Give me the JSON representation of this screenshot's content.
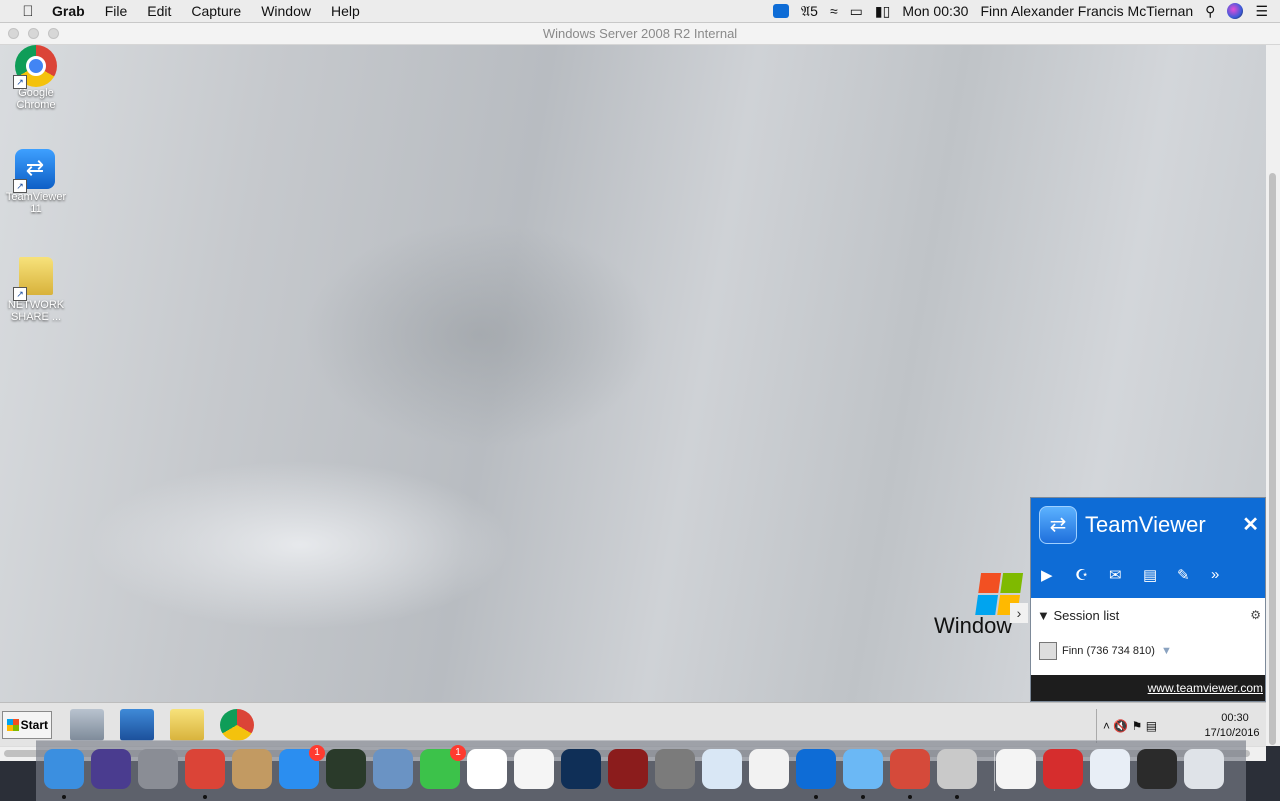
{
  "menubar": {
    "app_name": "Grab",
    "menus": [
      "File",
      "Edit",
      "Capture",
      "Window",
      "Help"
    ],
    "status": {
      "input_badge": "5",
      "clock": "Mon 00:30",
      "user_name": "Finn Alexander Francis McTiernan"
    }
  },
  "window": {
    "title": "Windows Server 2008 R2 Internal"
  },
  "desktop": {
    "icons": [
      {
        "label": "Google Chrome",
        "icon": "chrome-icon"
      },
      {
        "label": "TeamViewer 11",
        "icon": "teamviewer-icon"
      },
      {
        "label": "NETWORK SHARE ...",
        "icon": "folder-icon"
      }
    ],
    "brand_text": "Window"
  },
  "teamviewer": {
    "title": "TeamViewer",
    "toolbar_icons": [
      "video-icon",
      "headset-icon",
      "chat-icon",
      "file-transfer-icon",
      "tools-icon",
      "more-icon"
    ],
    "session_list_label": "Session list",
    "session_user": "Finn (736 734 810)",
    "footer_link": "www.teamviewer.com",
    "accent_color": "#0e6cd6"
  },
  "taskbar": {
    "start_label": "Start",
    "apps": [
      "server-manager-icon",
      "powershell-icon",
      "explorer-icon",
      "chrome-icon"
    ],
    "clock_time": "00:30",
    "clock_date": "17/10/2016"
  },
  "dock": {
    "items": [
      {
        "name": "finder-icon",
        "color": "#3b8fe0",
        "running": true
      },
      {
        "name": "siri-icon",
        "color": "#4a3c8f",
        "running": false
      },
      {
        "name": "launchpad-icon",
        "color": "#8a8d95",
        "running": false
      },
      {
        "name": "chrome-icon",
        "color": "#db4437",
        "running": true
      },
      {
        "name": "contacts-icon",
        "color": "#c29a62",
        "running": false
      },
      {
        "name": "app-store-icon",
        "color": "#2b8ef0",
        "running": false,
        "badge": "1"
      },
      {
        "name": "activity-monitor-icon",
        "color": "#2a3a2a",
        "running": false
      },
      {
        "name": "preview-icon",
        "color": "#6a93c4",
        "running": false
      },
      {
        "name": "facetime-icon",
        "color": "#3cc24a",
        "running": false,
        "badge": "1"
      },
      {
        "name": "calendar-icon",
        "color": "#ffffff",
        "running": false
      },
      {
        "name": "itunes-icon",
        "color": "#f5f5f5",
        "running": false
      },
      {
        "name": "photoshop-icon",
        "color": "#0f2f57",
        "running": false
      },
      {
        "name": "photo-booth-icon",
        "color": "#8b1c1c",
        "running": false
      },
      {
        "name": "system-preferences-icon",
        "color": "#7b7b7b",
        "running": false
      },
      {
        "name": "mail-icon",
        "color": "#d9e7f5",
        "running": false
      },
      {
        "name": "photos-icon",
        "color": "#f2f2f2",
        "running": false
      },
      {
        "name": "teamviewer-icon",
        "color": "#0e6cd6",
        "running": true
      },
      {
        "name": "messages-icon",
        "color": "#6bb8f5",
        "running": true
      },
      {
        "name": "remote-desktop-icon",
        "color": "#d54a3a",
        "running": true
      },
      {
        "name": "grab-icon",
        "color": "#c9c9c9",
        "running": true
      },
      {
        "name": "document-icon",
        "color": "#f4f4f4",
        "running": false
      },
      {
        "name": "jersey-icon",
        "color": "#d62d2d",
        "running": false
      },
      {
        "name": "screenshot-icon",
        "color": "#e8eef6",
        "running": false
      },
      {
        "name": "chrome-window-icon",
        "color": "#2b2b2b",
        "running": false
      },
      {
        "name": "trash-icon",
        "color": "#dfe3e8",
        "running": false
      }
    ]
  }
}
